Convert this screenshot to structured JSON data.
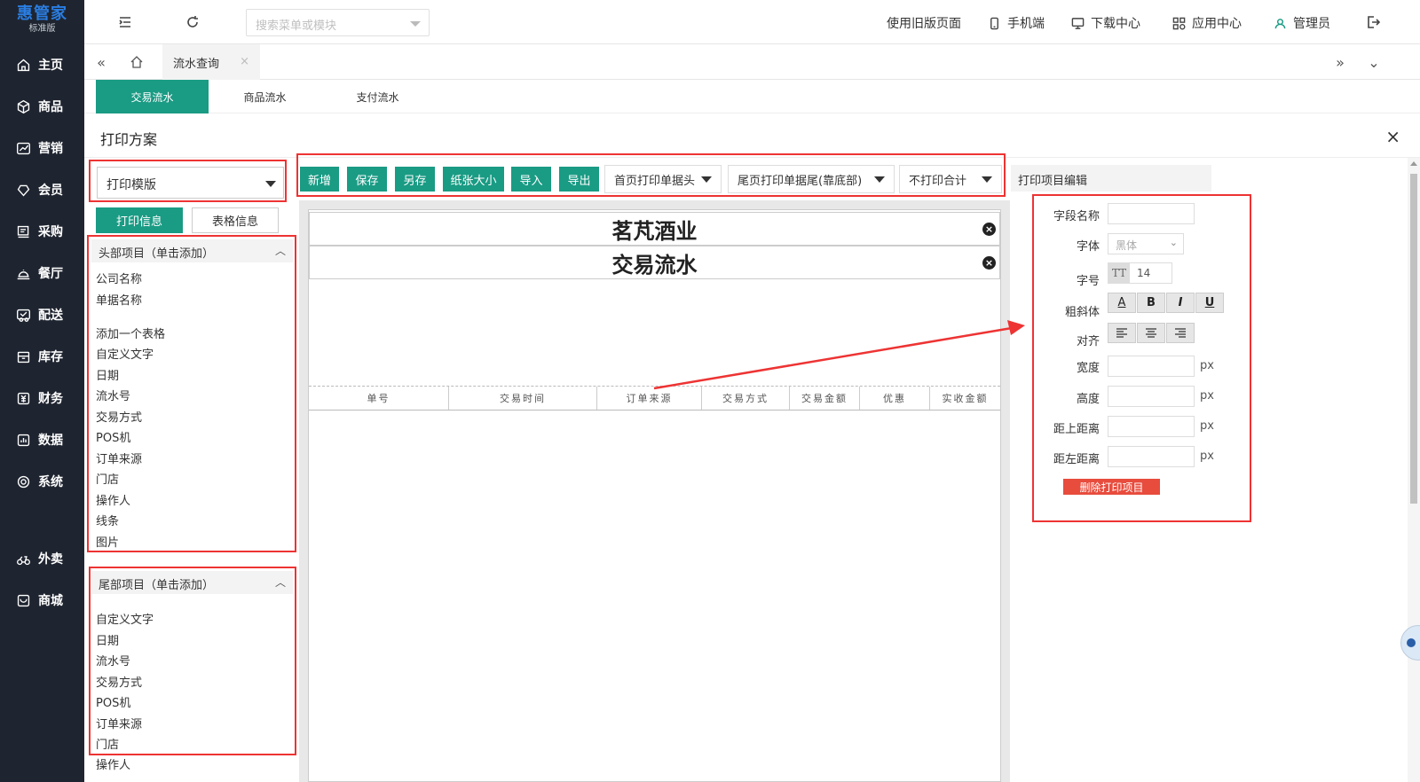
{
  "app": {
    "logo_main": "惠管家",
    "logo_sub": "标准版"
  },
  "sidebar": {
    "items": [
      {
        "label": "主页",
        "icon": "home-icon"
      },
      {
        "label": "商品",
        "icon": "box-icon"
      },
      {
        "label": "营销",
        "icon": "chart-icon"
      },
      {
        "label": "会员",
        "icon": "diamond-icon"
      },
      {
        "label": "采购",
        "icon": "purchase-icon"
      },
      {
        "label": "餐厅",
        "icon": "dish-icon"
      },
      {
        "label": "配送",
        "icon": "delivery-icon"
      },
      {
        "label": "库存",
        "icon": "inventory-icon"
      },
      {
        "label": "财务",
        "icon": "finance-icon"
      },
      {
        "label": "数据",
        "icon": "data-icon"
      },
      {
        "label": "系统",
        "icon": "system-icon"
      },
      {
        "label": "外卖",
        "icon": "takeout-icon"
      },
      {
        "label": "商城",
        "icon": "mall-icon"
      }
    ]
  },
  "topbar": {
    "search_placeholder": "搜索菜单或模块",
    "old_page": "使用旧版页面",
    "mobile": "手机端",
    "download": "下载中心",
    "apps": "应用中心",
    "user": "管理员"
  },
  "tabs": {
    "active": "流水查询",
    "close": "×"
  },
  "subtabs": [
    "交易流水",
    "商品流水",
    "支付流水"
  ],
  "panel": {
    "title": "打印方案",
    "close": "×"
  },
  "left": {
    "template_select": "打印模版",
    "btn_print_info": "打印信息",
    "btn_table_info": "表格信息",
    "header_section": "头部项目（单击添加）",
    "header_items": [
      "公司名称",
      "单据名称",
      "",
      "添加一个表格",
      "自定义文字",
      "日期",
      "流水号",
      "交易方式",
      "POS机",
      "订单来源",
      "门店",
      "操作人",
      "线条",
      "图片"
    ],
    "footer_section": "尾部项目（单击添加）",
    "footer_items": [
      "自定义文字",
      "日期",
      "流水号",
      "交易方式",
      "POS机",
      "订单来源",
      "门店",
      "操作人"
    ]
  },
  "toolbar": {
    "new": "新增",
    "save": "保存",
    "save_as": "另存",
    "paper_size": "纸张大小",
    "import": "导入",
    "export": "导出",
    "header_option": "首页打印单据头",
    "footer_option": "尾页打印单据尾(靠底部)",
    "total_option": "不打印合计",
    "edit_title": "打印项目编辑"
  },
  "canvas": {
    "company": "茗芃酒业",
    "doc_name": "交易流水",
    "columns": [
      "单号",
      "交易时间",
      "订单来源",
      "交易方式",
      "交易金额",
      "优惠",
      "实收金额"
    ]
  },
  "edit_form": {
    "field_name": "字段名称",
    "font": "字体",
    "font_value": "黑体",
    "size": "字号",
    "size_icon": "TT",
    "size_value": "14",
    "style": "粗斜体",
    "style_buttons": [
      "A",
      "B",
      "I",
      "U"
    ],
    "align": "对齐",
    "width": "宽度",
    "height": "高度",
    "top": "距上距离",
    "left": "距左距离",
    "unit": "px",
    "delete": "删除打印项目"
  },
  "colors": {
    "sidebar_bg": "#1f2530",
    "accent": "#1a9b84",
    "highlight": "#e33333",
    "danger": "#e84c3d"
  }
}
